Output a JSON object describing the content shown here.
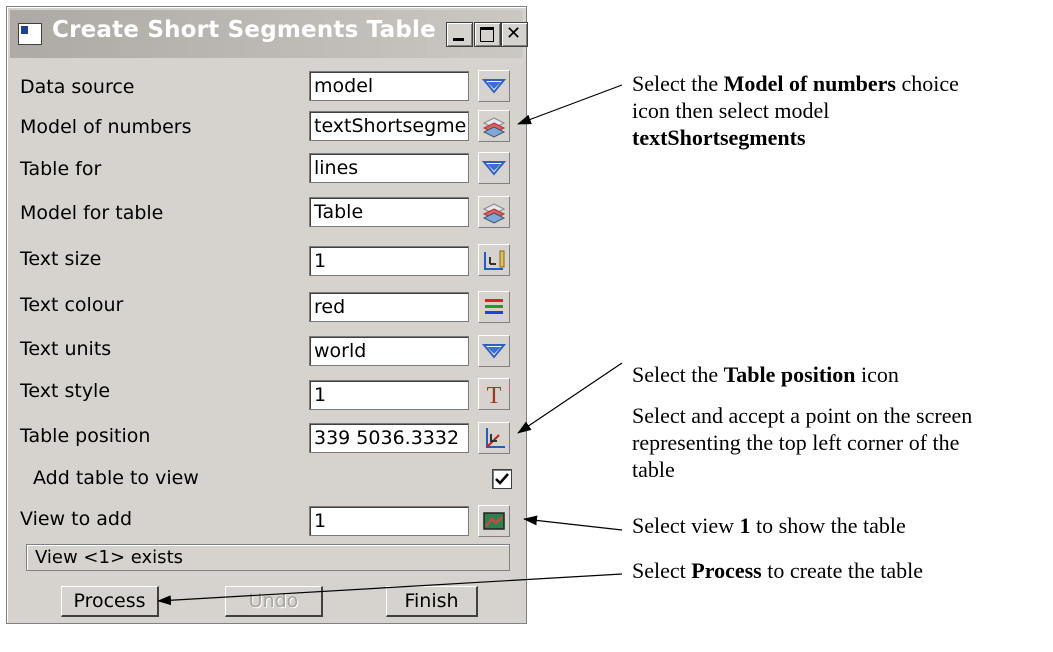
{
  "window": {
    "title": "Create Short Segments Table"
  },
  "fields": [
    {
      "label": "Data source",
      "value": "model",
      "icon": "dropdown-icon"
    },
    {
      "label": "Model of numbers",
      "value": "textShortsegme",
      "icon": "model-layers-icon"
    },
    {
      "label": "Table for",
      "value": "lines",
      "icon": "dropdown-icon"
    },
    {
      "label": "Model for table",
      "value": "Table",
      "icon": "model-layers-icon"
    },
    {
      "label": "Text size",
      "value": "1",
      "icon": "ruler-icon"
    },
    {
      "label": "Text colour",
      "value": "red",
      "icon": "colour-icon"
    },
    {
      "label": "Text units",
      "value": "world",
      "icon": "dropdown-icon"
    },
    {
      "label": "Text style",
      "value": "1",
      "icon": "text-style-icon"
    },
    {
      "label": "Table position",
      "value": "339 5036.3332",
      "icon": "pick-point-icon"
    }
  ],
  "add_to_view": {
    "label": "Add table to view",
    "checked": true
  },
  "view_to_add": {
    "label": "View to add",
    "value": "1",
    "icon": "view-icon"
  },
  "status": "View <1> exists",
  "buttons": {
    "process": "Process",
    "undo": "Undo",
    "finish": "Finish"
  },
  "annotations": {
    "a1_pre": "Select the ",
    "a1_bold1": "Model of numbers",
    "a1_mid1": " choice",
    "a1_mid2": "icon then select model",
    "a1_bold2": "textShortsegments",
    "a2_pre": "Select the ",
    "a2_bold": "Table position",
    "a2_post": " icon",
    "a3_line1": "Select and accept a point on the screen",
    "a3_line2": "representing the top left corner of the",
    "a3_line3": "table",
    "a4_pre": "Select view ",
    "a4_bold": "1",
    "a4_post": " to show the table",
    "a5_pre": "Select ",
    "a5_bold": "Process",
    "a5_post": " to create the table"
  },
  "colors": {
    "title_bar": "#ada9a4",
    "dialog_bg": "#d6d3ce",
    "dropdown_blue": "#3b6fd6"
  }
}
